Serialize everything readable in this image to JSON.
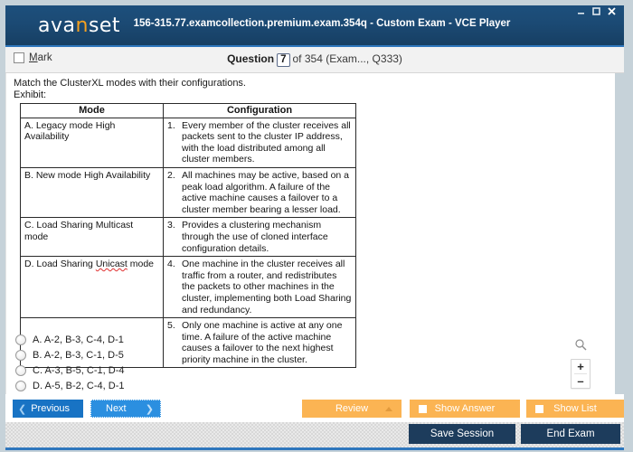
{
  "window": {
    "title": "156-315.77.examcollection.premium.exam.354q - Custom Exam - VCE Player",
    "logo_text_a": "ava",
    "logo_text_n": "n",
    "logo_text_b": "set",
    "minimize_icon": "minimize-icon",
    "maximize_icon": "maximize-icon",
    "close_icon": "close-icon"
  },
  "question_bar": {
    "mark_label": "Mark",
    "mark_accel": "M",
    "mark_rest": "ark",
    "question_word": "Question",
    "question_number": "7",
    "of_text": "of 354",
    "source_text": "(Exam..., Q333)"
  },
  "content": {
    "stem_line1": "Match the ClusterXL modes with their configurations.",
    "stem_line2": "Exhibit:",
    "table": {
      "headers": [
        "Mode",
        "Configuration"
      ],
      "modes": [
        "A. Legacy mode High Availability",
        "B. New mode High Availability",
        "C. Load Sharing Multicast mode",
        "D. Load Sharing Unicast mode",
        ""
      ],
      "configs": [
        {
          "num": "1.",
          "text": "Every member of the cluster receives all packets sent to the cluster IP address, with the load distributed among all cluster members."
        },
        {
          "num": "2.",
          "text": "All machines may be active, based on a peak load algorithm. A failure of the active machine causes a failover to a cluster member bearing a lesser load."
        },
        {
          "num": "3.",
          "text": "Provides a clustering mechanism through the use of cloned interface configuration details."
        },
        {
          "num": "4.",
          "text": "One machine in the cluster receives all traffic from a router, and redistributes the packets to other machines in the cluster, implementing both Load Sharing and redundancy."
        },
        {
          "num": "5.",
          "text": "Only one machine is active at any one time. A failure of the active machine causes a failover to the next highest priority machine in the cluster."
        }
      ]
    },
    "options": [
      "A.  A-2, B-3, C-4, D-1",
      "B.  A-2, B-3, C-1, D-5",
      "C.  A-3, B-5, C-1, D-4",
      "D.  A-5, B-2, C-4, D-1"
    ]
  },
  "zoom_widget": {
    "magnifier_icon": "magnifier-icon",
    "zoom_in": "+",
    "zoom_out": "–"
  },
  "actions": {
    "previous": "Previous",
    "next": "Next",
    "review": "Review",
    "show_answer": "Show Answer",
    "show_list": "Show List",
    "save_session": "Save Session",
    "end_exam": "End Exam"
  },
  "colors": {
    "header_blue": "#1b4a74",
    "accent_blue": "#2f77bd",
    "button_blue": "#1873c4",
    "next_blue": "#2b8fe0",
    "orange": "#fbb453",
    "dark_navy": "#1d3c5c",
    "logo_orange": "#f5a11f"
  }
}
